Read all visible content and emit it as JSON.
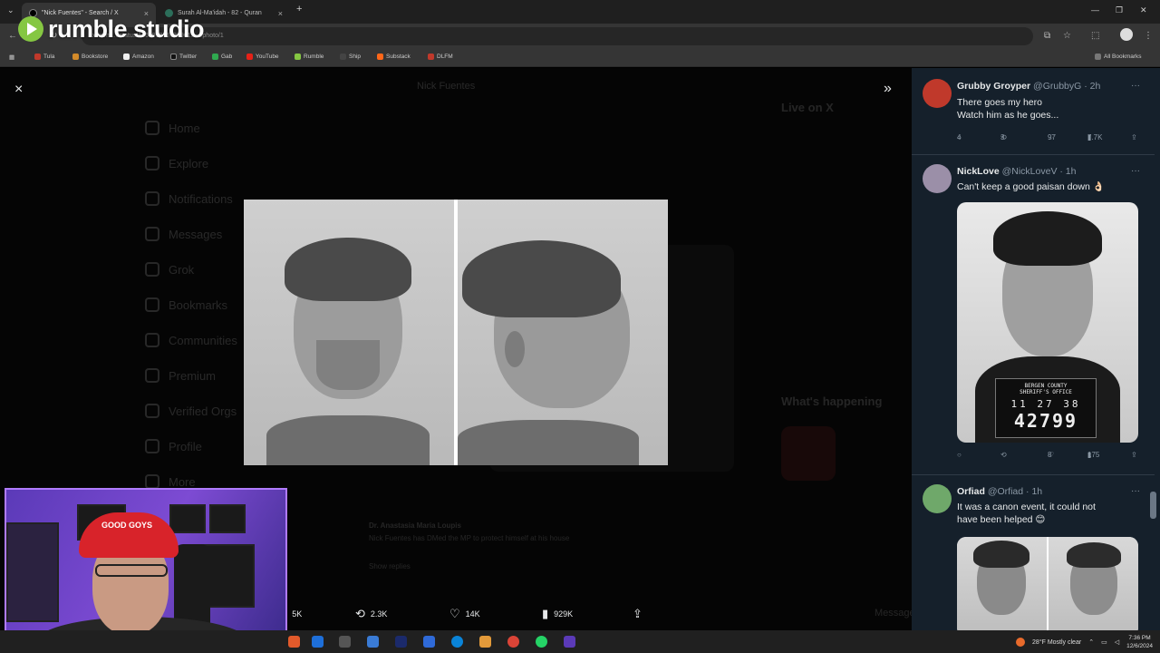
{
  "browser": {
    "tabs": [
      {
        "title": "\"Nick Fuentes\" - Search / X",
        "close": "×"
      },
      {
        "title": "Surah Al-Ma'idah - 82 - Quran",
        "close": "×"
      }
    ],
    "new_tab": "+",
    "url": "x.com/…/status/1864918157369615…/photo/1",
    "bookmarks": [
      {
        "label": "Tula",
        "color": "#c0392b"
      },
      {
        "label": "Bookstore",
        "color": "#d38b2a"
      },
      {
        "label": "Amazon",
        "color": "#f0f0f0"
      },
      {
        "label": "Twitter",
        "color": "#111111"
      },
      {
        "label": "Gab",
        "color": "#2fa84f"
      },
      {
        "label": "YouTube",
        "color": "#e62117"
      },
      {
        "label": "Rumble",
        "color": "#85c742"
      },
      {
        "label": "Ship",
        "color": "#444444"
      },
      {
        "label": "Substack",
        "color": "#ff6719"
      },
      {
        "label": "DLFM",
        "color": "#c0392b"
      }
    ],
    "all_bookmarks": "All Bookmarks",
    "window_controls": [
      "—",
      "❐",
      "✕"
    ]
  },
  "overlay": {
    "brand_name": "rumble studio",
    "brand_color": "#85c742"
  },
  "viewer": {
    "close_symbol": "×",
    "expand_symbol": "»",
    "actions": {
      "replies": "5K",
      "reposts": "2.3K",
      "likes": "14K",
      "views": "929K"
    },
    "background_page": {
      "nav": [
        "Home",
        "Explore",
        "Notifications",
        "Messages",
        "Grok",
        "Bookmarks",
        "Communities",
        "Premium",
        "Verified Orgs",
        "Profile",
        "More"
      ],
      "search_text": "Nick Fuentes",
      "live_heading": "Live on X",
      "happening_heading": "What's happening",
      "reply_author": "Dr. Anastasia Maria Loupis",
      "reply_text": "Nick Fuentes has DMed the MP to protect himself at his house",
      "show_replies": "Show replies",
      "messages_label": "Messages"
    }
  },
  "replies": [
    {
      "name": "Grubby Groyper",
      "handle": "@GrubbyG",
      "time": "· 2h",
      "text_lines": [
        "There goes my hero",
        "Watch him as he goes..."
      ],
      "stats": {
        "replies": "4",
        "reposts": "3",
        "likes": "97",
        "views": "7.7K"
      },
      "avatar_color": "#c0392b"
    },
    {
      "name": "NickLove",
      "handle": "@NickLoveV",
      "time": "· 1h",
      "text_lines": [
        "Can't keep a good paisan down 👌🏻"
      ],
      "stats": {
        "replies": "",
        "reposts": "",
        "likes": "8",
        "views": "175"
      },
      "avatar_color": "#9b8fa8",
      "photo_caption": {
        "line1": "BERGEN COUNTY",
        "line2": "SHERIFF'S OFFICE",
        "date": "11 27 38",
        "number": "42799"
      }
    },
    {
      "name": "Orfiad",
      "handle": "@Orfiad",
      "time": "· 1h",
      "text_lines": [
        "It was a canon event, it could not",
        "have been helped 😊"
      ],
      "avatar_color": "#6fa86a"
    }
  ],
  "webcam": {
    "cap_text": "GOOD GOYS"
  },
  "taskbar": {
    "weather": "28°F  Mostly clear",
    "time": "7:36 PM",
    "date": "12/6/2024"
  }
}
